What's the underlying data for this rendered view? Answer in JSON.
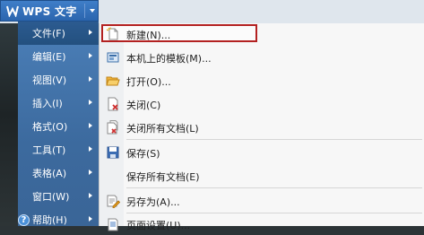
{
  "app": {
    "title": "WPS 文字",
    "accent_color": "#2b65ae"
  },
  "left_menu": {
    "items": [
      {
        "label": "文件(F)",
        "active": true
      },
      {
        "label": "编辑(E)"
      },
      {
        "label": "视图(V)"
      },
      {
        "label": "插入(I)"
      },
      {
        "label": "格式(O)"
      },
      {
        "label": "工具(T)"
      },
      {
        "label": "表格(A)"
      },
      {
        "label": "窗口(W)"
      },
      {
        "label": "帮助(H)",
        "icon": "help-icon"
      }
    ]
  },
  "file_submenu": {
    "items": [
      {
        "label": "新建(N)...",
        "icon": "new-document-icon",
        "selected": true
      },
      {
        "label": "本机上的模板(M)...",
        "icon": "template-icon"
      },
      {
        "label": "打开(O)...",
        "icon": "open-folder-icon"
      },
      {
        "label": "关闭(C)",
        "icon": "close-document-icon"
      },
      {
        "label": "关闭所有文档(L)",
        "icon": "close-all-documents-icon"
      },
      {
        "label": "保存(S)",
        "icon": "save-icon"
      },
      {
        "label": "保存所有文档(E)",
        "icon": ""
      },
      {
        "label": "另存为(A)...",
        "icon": "save-as-icon"
      },
      {
        "label": "页面设置(U)...",
        "icon": "page-setup-icon"
      }
    ]
  }
}
